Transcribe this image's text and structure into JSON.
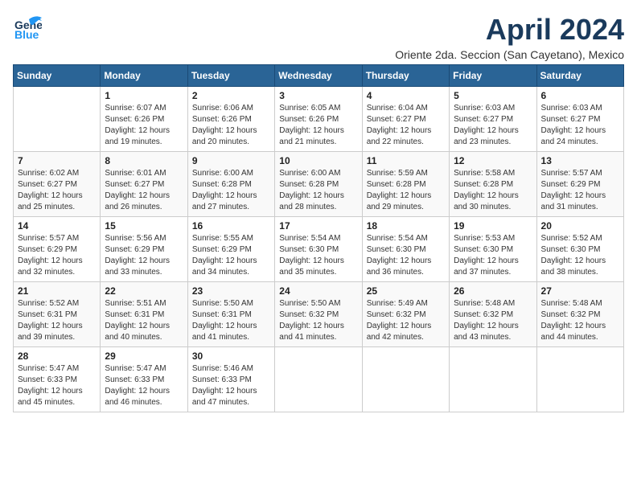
{
  "logo": {
    "line1": "General",
    "line2": "Blue"
  },
  "title": "April 2024",
  "location": "Oriente 2da. Seccion (San Cayetano), Mexico",
  "days_of_week": [
    "Sunday",
    "Monday",
    "Tuesday",
    "Wednesday",
    "Thursday",
    "Friday",
    "Saturday"
  ],
  "weeks": [
    [
      {
        "day": null
      },
      {
        "day": "1",
        "sunrise": "6:07 AM",
        "sunset": "6:26 PM",
        "daylight": "12 hours and 19 minutes."
      },
      {
        "day": "2",
        "sunrise": "6:06 AM",
        "sunset": "6:26 PM",
        "daylight": "12 hours and 20 minutes."
      },
      {
        "day": "3",
        "sunrise": "6:05 AM",
        "sunset": "6:26 PM",
        "daylight": "12 hours and 21 minutes."
      },
      {
        "day": "4",
        "sunrise": "6:04 AM",
        "sunset": "6:27 PM",
        "daylight": "12 hours and 22 minutes."
      },
      {
        "day": "5",
        "sunrise": "6:03 AM",
        "sunset": "6:27 PM",
        "daylight": "12 hours and 23 minutes."
      },
      {
        "day": "6",
        "sunrise": "6:03 AM",
        "sunset": "6:27 PM",
        "daylight": "12 hours and 24 minutes."
      }
    ],
    [
      {
        "day": "7",
        "sunrise": "6:02 AM",
        "sunset": "6:27 PM",
        "daylight": "12 hours and 25 minutes."
      },
      {
        "day": "8",
        "sunrise": "6:01 AM",
        "sunset": "6:27 PM",
        "daylight": "12 hours and 26 minutes."
      },
      {
        "day": "9",
        "sunrise": "6:00 AM",
        "sunset": "6:28 PM",
        "daylight": "12 hours and 27 minutes."
      },
      {
        "day": "10",
        "sunrise": "6:00 AM",
        "sunset": "6:28 PM",
        "daylight": "12 hours and 28 minutes."
      },
      {
        "day": "11",
        "sunrise": "5:59 AM",
        "sunset": "6:28 PM",
        "daylight": "12 hours and 29 minutes."
      },
      {
        "day": "12",
        "sunrise": "5:58 AM",
        "sunset": "6:28 PM",
        "daylight": "12 hours and 30 minutes."
      },
      {
        "day": "13",
        "sunrise": "5:57 AM",
        "sunset": "6:29 PM",
        "daylight": "12 hours and 31 minutes."
      }
    ],
    [
      {
        "day": "14",
        "sunrise": "5:57 AM",
        "sunset": "6:29 PM",
        "daylight": "12 hours and 32 minutes."
      },
      {
        "day": "15",
        "sunrise": "5:56 AM",
        "sunset": "6:29 PM",
        "daylight": "12 hours and 33 minutes."
      },
      {
        "day": "16",
        "sunrise": "5:55 AM",
        "sunset": "6:29 PM",
        "daylight": "12 hours and 34 minutes."
      },
      {
        "day": "17",
        "sunrise": "5:54 AM",
        "sunset": "6:30 PM",
        "daylight": "12 hours and 35 minutes."
      },
      {
        "day": "18",
        "sunrise": "5:54 AM",
        "sunset": "6:30 PM",
        "daylight": "12 hours and 36 minutes."
      },
      {
        "day": "19",
        "sunrise": "5:53 AM",
        "sunset": "6:30 PM",
        "daylight": "12 hours and 37 minutes."
      },
      {
        "day": "20",
        "sunrise": "5:52 AM",
        "sunset": "6:30 PM",
        "daylight": "12 hours and 38 minutes."
      }
    ],
    [
      {
        "day": "21",
        "sunrise": "5:52 AM",
        "sunset": "6:31 PM",
        "daylight": "12 hours and 39 minutes."
      },
      {
        "day": "22",
        "sunrise": "5:51 AM",
        "sunset": "6:31 PM",
        "daylight": "12 hours and 40 minutes."
      },
      {
        "day": "23",
        "sunrise": "5:50 AM",
        "sunset": "6:31 PM",
        "daylight": "12 hours and 41 minutes."
      },
      {
        "day": "24",
        "sunrise": "5:50 AM",
        "sunset": "6:32 PM",
        "daylight": "12 hours and 41 minutes."
      },
      {
        "day": "25",
        "sunrise": "5:49 AM",
        "sunset": "6:32 PM",
        "daylight": "12 hours and 42 minutes."
      },
      {
        "day": "26",
        "sunrise": "5:48 AM",
        "sunset": "6:32 PM",
        "daylight": "12 hours and 43 minutes."
      },
      {
        "day": "27",
        "sunrise": "5:48 AM",
        "sunset": "6:32 PM",
        "daylight": "12 hours and 44 minutes."
      }
    ],
    [
      {
        "day": "28",
        "sunrise": "5:47 AM",
        "sunset": "6:33 PM",
        "daylight": "12 hours and 45 minutes."
      },
      {
        "day": "29",
        "sunrise": "5:47 AM",
        "sunset": "6:33 PM",
        "daylight": "12 hours and 46 minutes."
      },
      {
        "day": "30",
        "sunrise": "5:46 AM",
        "sunset": "6:33 PM",
        "daylight": "12 hours and 47 minutes."
      },
      {
        "day": null
      },
      {
        "day": null
      },
      {
        "day": null
      },
      {
        "day": null
      }
    ]
  ],
  "labels": {
    "sunrise": "Sunrise:",
    "sunset": "Sunset:",
    "daylight": "Daylight:"
  }
}
